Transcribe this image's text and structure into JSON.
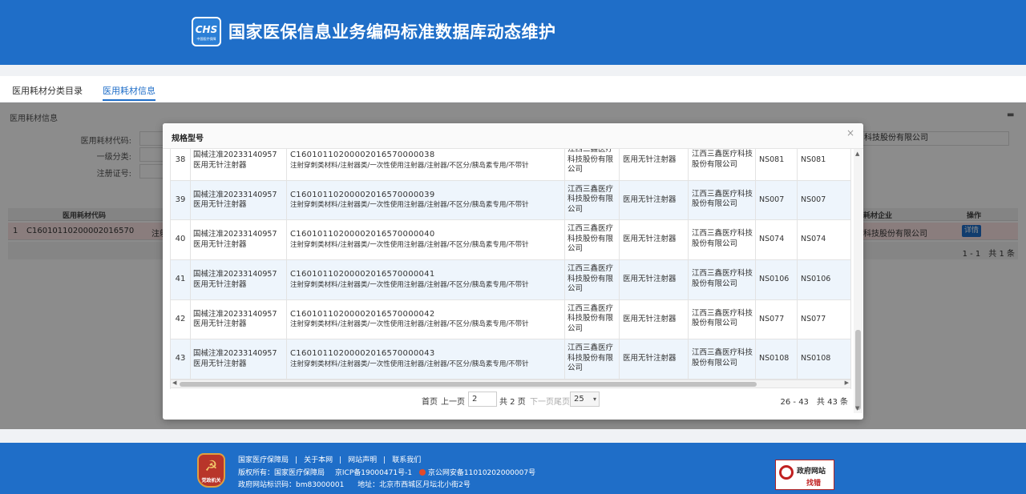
{
  "header": {
    "title": "国家医保信息业务编码标准数据库动态维护",
    "logo_text": "CHS",
    "logo_sub": "中国医疗保障"
  },
  "tabs": [
    {
      "label": "医用耗材分类目录"
    },
    {
      "label": "医用耗材信息",
      "active": true
    }
  ],
  "panel": {
    "title": "医用耗材信息",
    "fields": {
      "code_label": "医用耗材代码:",
      "category_label": "一级分类:",
      "reg_label": "注册证号:"
    },
    "company_value": "科技股份有限公司",
    "grid": {
      "headers": {
        "code": "医用耗材代码",
        "enterprise": "耗材企业",
        "action": "操作"
      },
      "row": {
        "index": "1",
        "code": "C16010110200002016570",
        "col3": "注射",
        "enterprise": "科技股份有限公司",
        "action": "详情"
      },
      "footer": "1 - 1　共 1 条"
    }
  },
  "modal": {
    "title": "规格型号",
    "close": "×",
    "rows": [
      {
        "no": "38",
        "reg": "国械注准20233140957",
        "reg_name": "医用无针注射器",
        "code": "C16010110200002016570000038",
        "cls": "注射穿刺类材料/注射器类/一次性使用注射器/注射器/不区分/胰岛素专用/不带针",
        "company": "江西三鑫医疗科技股份有限公司",
        "name": "医用无针注射器",
        "ent": "江西三鑫医疗科技股份有限公司",
        "m1": "NS081",
        "m2": "NS081"
      },
      {
        "no": "39",
        "reg": "国械注准20233140957",
        "reg_name": "医用无针注射器",
        "code": "C16010110200002016570000039",
        "cls": "注射穿刺类材料/注射器类/一次性使用注射器/注射器/不区分/胰岛素专用/不带针",
        "company": "江西三鑫医疗科技股份有限公司",
        "name": "医用无针注射器",
        "ent": "江西三鑫医疗科技股份有限公司",
        "m1": "NS007",
        "m2": "NS007"
      },
      {
        "no": "40",
        "reg": "国械注准20233140957",
        "reg_name": "医用无针注射器",
        "code": "C16010110200002016570000040",
        "cls": "注射穿刺类材料/注射器类/一次性使用注射器/注射器/不区分/胰岛素专用/不带针",
        "company": "江西三鑫医疗科技股份有限公司",
        "name": "医用无针注射器",
        "ent": "江西三鑫医疗科技股份有限公司",
        "m1": "NS074",
        "m2": "NS074"
      },
      {
        "no": "41",
        "reg": "国械注准20233140957",
        "reg_name": "医用无针注射器",
        "code": "C16010110200002016570000041",
        "cls": "注射穿刺类材料/注射器类/一次性使用注射器/注射器/不区分/胰岛素专用/不带针",
        "company": "江西三鑫医疗科技股份有限公司",
        "name": "医用无针注射器",
        "ent": "江西三鑫医疗科技股份有限公司",
        "m1": "NS0106",
        "m2": "NS0106"
      },
      {
        "no": "42",
        "reg": "国械注准20233140957",
        "reg_name": "医用无针注射器",
        "code": "C16010110200002016570000042",
        "cls": "注射穿刺类材料/注射器类/一次性使用注射器/注射器/不区分/胰岛素专用/不带针",
        "company": "江西三鑫医疗科技股份有限公司",
        "name": "医用无针注射器",
        "ent": "江西三鑫医疗科技股份有限公司",
        "m1": "NS077",
        "m2": "NS077"
      },
      {
        "no": "43",
        "reg": "国械注准20233140957",
        "reg_name": "医用无针注射器",
        "code": "C16010110200002016570000043",
        "cls": "注射穿刺类材料/注射器类/一次性使用注射器/注射器/不区分/胰岛素专用/不带针",
        "company": "江西三鑫医疗科技股份有限公司",
        "name": "医用无针注射器",
        "ent": "江西三鑫医疗科技股份有限公司",
        "m1": "NS0108",
        "m2": "NS0108"
      }
    ],
    "pager": {
      "first": "首页",
      "prev": "上一页",
      "page_input": "2",
      "total_pages": "共 2 页",
      "next": "下一页",
      "last": "尾页",
      "page_size": "25",
      "summary": "26 - 43　共 43 条"
    }
  },
  "footer": {
    "links": [
      "国家医疗保障局",
      "关于本网",
      "网站声明",
      "联系我们"
    ],
    "copyright": "版权所有：国家医疗保障局",
    "icp": "京ICP备19000471号-1",
    "police": "京公网安备11010202000007号",
    "site_id": "政府网站标识码：bm83000001",
    "address": "地址：北京市西城区月坛北小街2号",
    "emblem_label": "党政机关",
    "gov_badge": {
      "line1": "政府网站",
      "line2": "找错"
    }
  }
}
